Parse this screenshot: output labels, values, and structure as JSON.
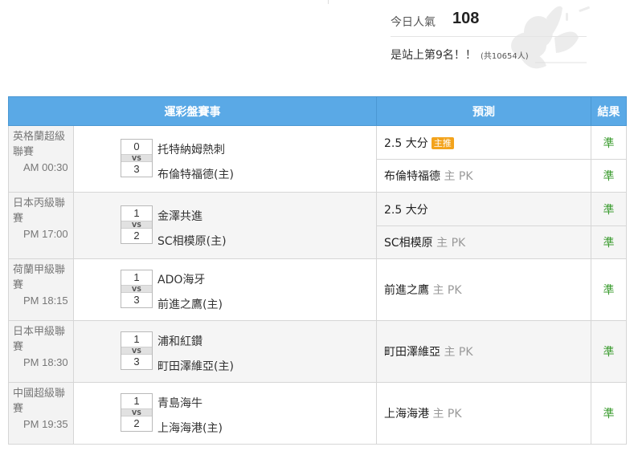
{
  "stats": {
    "popularity_label": "今日人氣",
    "popularity_value": "108",
    "rank_text": "是站上第9名！！",
    "rank_note": "(共10654人)"
  },
  "table": {
    "headers": [
      "運彩盤賽事",
      "預測",
      "結果"
    ],
    "matches": [
      {
        "league": "英格蘭超級聯賽",
        "time": "AM 00:30",
        "home_score": "0",
        "away_score": "3",
        "vs": "VS",
        "team1": "托特納姆熱刺",
        "team2": "布倫特福德(主)",
        "preds": [
          {
            "main": "2.5 大分",
            "side": "",
            "badge": "主推",
            "result": "準"
          },
          {
            "main": "布倫特福德",
            "side": "主 PK",
            "badge": "",
            "result": "準"
          }
        ]
      },
      {
        "league": "日本丙級聯賽",
        "time": "PM 17:00",
        "home_score": "1",
        "away_score": "2",
        "vs": "VS",
        "team1": "金澤共進",
        "team2": "SC相模原(主)",
        "preds": [
          {
            "main": "2.5 大分",
            "side": "",
            "badge": "",
            "result": "準"
          },
          {
            "main": "SC相模原",
            "side": "主 PK",
            "badge": "",
            "result": "準"
          }
        ]
      },
      {
        "league": "荷蘭甲級聯賽",
        "time": "PM 18:15",
        "home_score": "1",
        "away_score": "3",
        "vs": "VS",
        "team1": "ADO海牙",
        "team2": "前進之鷹(主)",
        "preds": [
          {
            "main": "前進之鷹",
            "side": "主 PK",
            "badge": "",
            "result": "準"
          }
        ]
      },
      {
        "league": "日本甲級聯賽",
        "time": "PM 18:30",
        "home_score": "1",
        "away_score": "3",
        "vs": "VS",
        "team1": "浦和紅鑽",
        "team2": "町田澤維亞(主)",
        "preds": [
          {
            "main": "町田澤維亞",
            "side": "主 PK",
            "badge": "",
            "result": "準"
          }
        ]
      },
      {
        "league": "中國超級聯賽",
        "time": "PM 19:35",
        "home_score": "1",
        "away_score": "2",
        "vs": "VS",
        "team1": "青島海牛",
        "team2": "上海海港(主)",
        "preds": [
          {
            "main": "上海海港",
            "side": "主 PK",
            "badge": "",
            "result": "準"
          }
        ]
      }
    ]
  },
  "colors": {
    "header_bg": "#5aa9e6",
    "result_green": "#3a9b2e",
    "badge_orange": "#f3a31c"
  },
  "icons": {
    "decoration": "butterfly-mascot-icon"
  }
}
